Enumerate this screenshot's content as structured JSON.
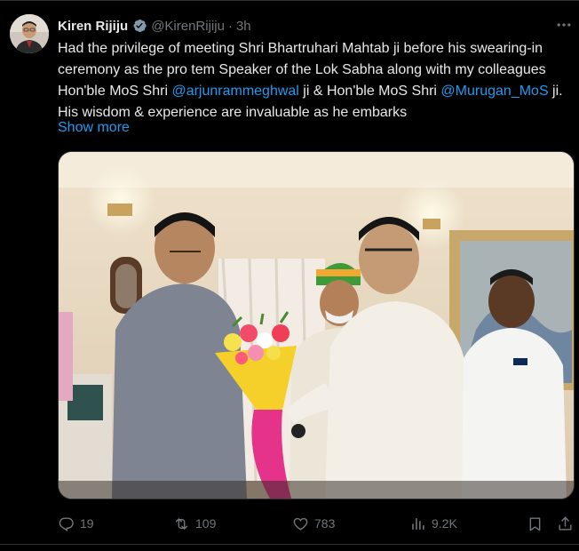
{
  "tweet": {
    "author_name": "Kiren Rijiju",
    "handle": "@KirenRijiju",
    "separator": "·",
    "time": "3h",
    "text_segments": [
      {
        "type": "text",
        "value": "Had the privilege of meeting Shri Bhartruhari Mahtab ji before his swearing-in ceremony as the pro tem Speaker of the Lok Sabha along with my colleagues Hon'ble MoS Shri "
      },
      {
        "type": "mention",
        "value": "@arjunrammeghwal"
      },
      {
        "type": "text",
        "value": " ji & Hon'ble MoS Shri "
      },
      {
        "type": "mention",
        "value": "@Murugan_MoS"
      },
      {
        "type": "text",
        "value": " ji. His wisdom & experience are invaluable as he embarks"
      }
    ],
    "show_more": "Show more"
  },
  "icons": {
    "verified": "verified-badge-icon",
    "more": "more-options-icon",
    "reply": "reply-icon",
    "retweet": "retweet-icon",
    "like": "heart-icon",
    "views": "views-chart-icon",
    "bookmark": "bookmark-icon",
    "share": "share-icon"
  },
  "colors": {
    "background": "#000000",
    "text": "#e7e9ea",
    "muted": "#71767b",
    "link": "#1d9bf0",
    "verified": "#829aab",
    "divider": "#2f3336"
  },
  "actions": {
    "replies": "19",
    "retweets": "109",
    "likes": "783",
    "views": "9.2K"
  }
}
